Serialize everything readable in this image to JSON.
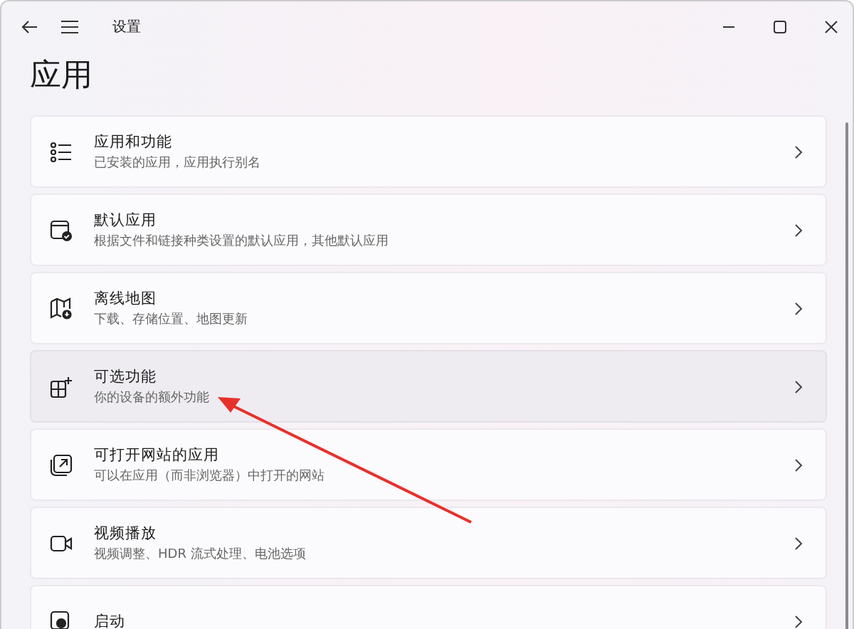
{
  "window": {
    "title": "设置"
  },
  "page": {
    "heading": "应用"
  },
  "items": [
    {
      "title": "应用和功能",
      "subtitle": "已安装的应用，应用执行别名",
      "selected": false
    },
    {
      "title": "默认应用",
      "subtitle": "根据文件和链接种类设置的默认应用，其他默认应用",
      "selected": false
    },
    {
      "title": "离线地图",
      "subtitle": "下载、存储位置、地图更新",
      "selected": false
    },
    {
      "title": "可选功能",
      "subtitle": "你的设备的额外功能",
      "selected": true
    },
    {
      "title": "可打开网站的应用",
      "subtitle": "可以在应用（而非浏览器）中打开的网站",
      "selected": false
    },
    {
      "title": "视频播放",
      "subtitle": "视频调整、HDR 流式处理、电池选项",
      "selected": false
    },
    {
      "title": "启动",
      "selected": false
    }
  ]
}
